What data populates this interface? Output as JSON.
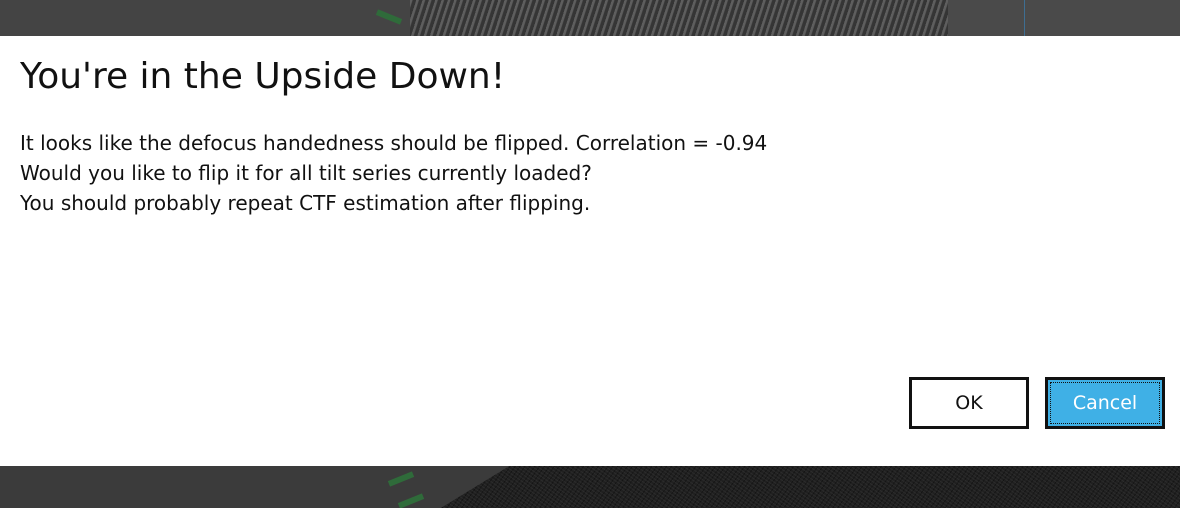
{
  "dialog": {
    "title": "You're in the Upside Down!",
    "message_lines": [
      "It looks like the defocus handedness should be flipped. Correlation = -0.94",
      "Would you like to flip it for all tilt series currently loaded?",
      "You should probably repeat CTF estimation after flipping."
    ],
    "buttons": {
      "ok_label": "OK",
      "cancel_label": "Cancel"
    }
  },
  "colors": {
    "dialog_background": "#ffffff",
    "cancel_button": "#3fb0e6",
    "backdrop": "#3d3d3d"
  }
}
